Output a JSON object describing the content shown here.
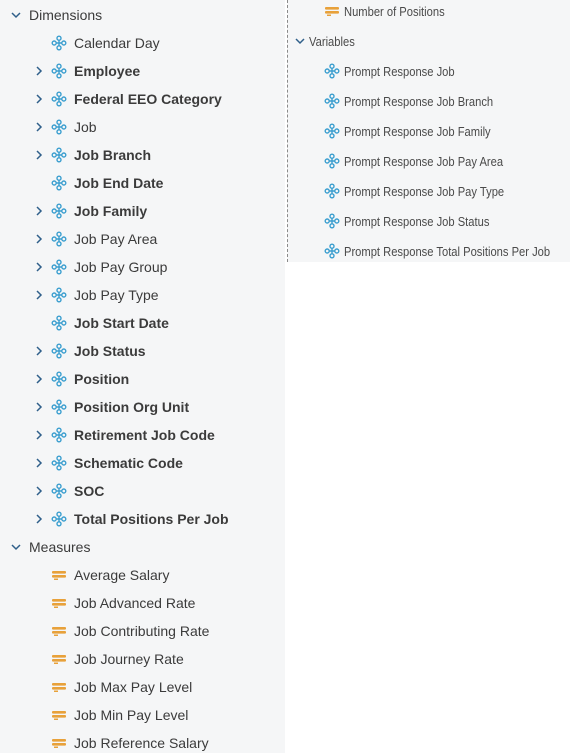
{
  "left_tree": {
    "dimensions_label": "Dimensions",
    "dimensions": [
      {
        "label": "Calendar Day",
        "bold": false,
        "expandable": false
      },
      {
        "label": "Employee",
        "bold": true,
        "expandable": true
      },
      {
        "label": "Federal EEO Category",
        "bold": true,
        "expandable": true
      },
      {
        "label": "Job",
        "bold": false,
        "expandable": true
      },
      {
        "label": "Job Branch",
        "bold": true,
        "expandable": true
      },
      {
        "label": "Job End Date",
        "bold": true,
        "expandable": false
      },
      {
        "label": "Job Family",
        "bold": true,
        "expandable": true
      },
      {
        "label": "Job Pay Area",
        "bold": false,
        "expandable": true
      },
      {
        "label": "Job Pay Group",
        "bold": false,
        "expandable": true
      },
      {
        "label": "Job Pay Type",
        "bold": false,
        "expandable": true
      },
      {
        "label": "Job Start Date",
        "bold": true,
        "expandable": false
      },
      {
        "label": "Job Status",
        "bold": true,
        "expandable": true
      },
      {
        "label": "Position",
        "bold": true,
        "expandable": true
      },
      {
        "label": "Position Org Unit",
        "bold": true,
        "expandable": true
      },
      {
        "label": "Retirement Job Code",
        "bold": true,
        "expandable": true
      },
      {
        "label": "Schematic Code",
        "bold": true,
        "expandable": true
      },
      {
        "label": "SOC",
        "bold": true,
        "expandable": true
      },
      {
        "label": "Total Positions Per Job",
        "bold": true,
        "expandable": true
      }
    ],
    "measures_label": "Measures",
    "measures": [
      {
        "label": "Average Salary"
      },
      {
        "label": "Job Advanced Rate"
      },
      {
        "label": "Job Contributing Rate"
      },
      {
        "label": "Job Journey Rate"
      },
      {
        "label": "Job Max Pay Level"
      },
      {
        "label": "Job Min Pay Level"
      },
      {
        "label": "Job Reference Salary"
      }
    ]
  },
  "right_tree": {
    "top_measure": {
      "label": "Number of Positions"
    },
    "variables_label": "Variables",
    "variables": [
      {
        "label": "Prompt Response Job"
      },
      {
        "label": "Prompt Response Job Branch"
      },
      {
        "label": "Prompt Response Job Family"
      },
      {
        "label": "Prompt Response Job Pay Area"
      },
      {
        "label": "Prompt Response Job Pay Type"
      },
      {
        "label": "Prompt Response Job Status"
      },
      {
        "label": "Prompt Response Total Positions Per Job"
      }
    ]
  },
  "icons": {
    "dimension": "dimension-icon",
    "measure": "measure-icon",
    "chevron_right": "chevron-right-icon",
    "chevron_down": "chevron-down-icon"
  },
  "colors": {
    "panel_bg": "#f5f6f7",
    "dimension_icon": "#3a9ecf",
    "measure_icon": "#e8a13a",
    "chevron": "#2f5f8a"
  }
}
